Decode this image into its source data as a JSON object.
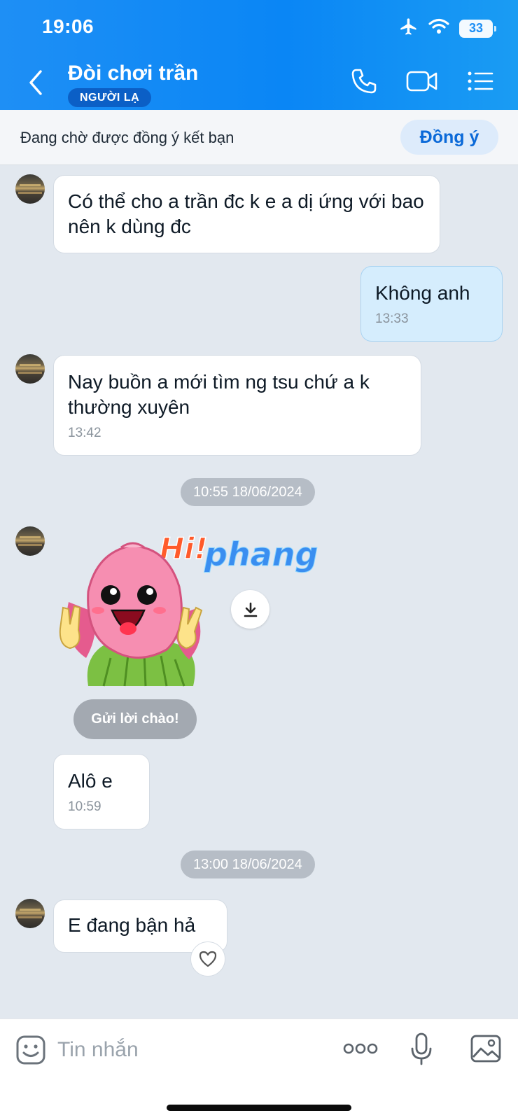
{
  "status_bar": {
    "time": "19:06",
    "battery": "33"
  },
  "header": {
    "title": "Đòi chơi trần",
    "badge": "NGƯỜI LẠ",
    "icons": [
      "back-chevron-icon",
      "phone-icon",
      "video-call-icon",
      "menu-list-icon"
    ]
  },
  "friend_request": {
    "text": "Đang chờ được đồng ý kết bạn",
    "accept_label": "Đồng ý"
  },
  "messages": [
    {
      "from": "them",
      "text": "Có thể cho a trần đc k e a dị ứng với bao nên k dùng đc"
    },
    {
      "from": "me",
      "text": "Không anh",
      "time": "13:33"
    },
    {
      "from": "them",
      "text": "Nay buồn a mới tìm ng tsu chứ a k thường xuyên",
      "time": "13:42"
    },
    {
      "from": "them",
      "text": "Alô e",
      "time": "10:59"
    },
    {
      "from": "them",
      "text": "E đang bận hả"
    }
  ],
  "date_separators": [
    "10:55 18/06/2024",
    "13:00 18/06/2024"
  ],
  "sticker": {
    "logo_text": "Hi!phang",
    "greet_label": "Gửi lời chào!"
  },
  "composer": {
    "placeholder": "Tin nhắn"
  },
  "colors": {
    "header_blue": "#1e8ff5",
    "accent_blue": "#0a69d8",
    "sent_bubble": "#d5edfd",
    "chat_bg": "#e2e8ef"
  }
}
